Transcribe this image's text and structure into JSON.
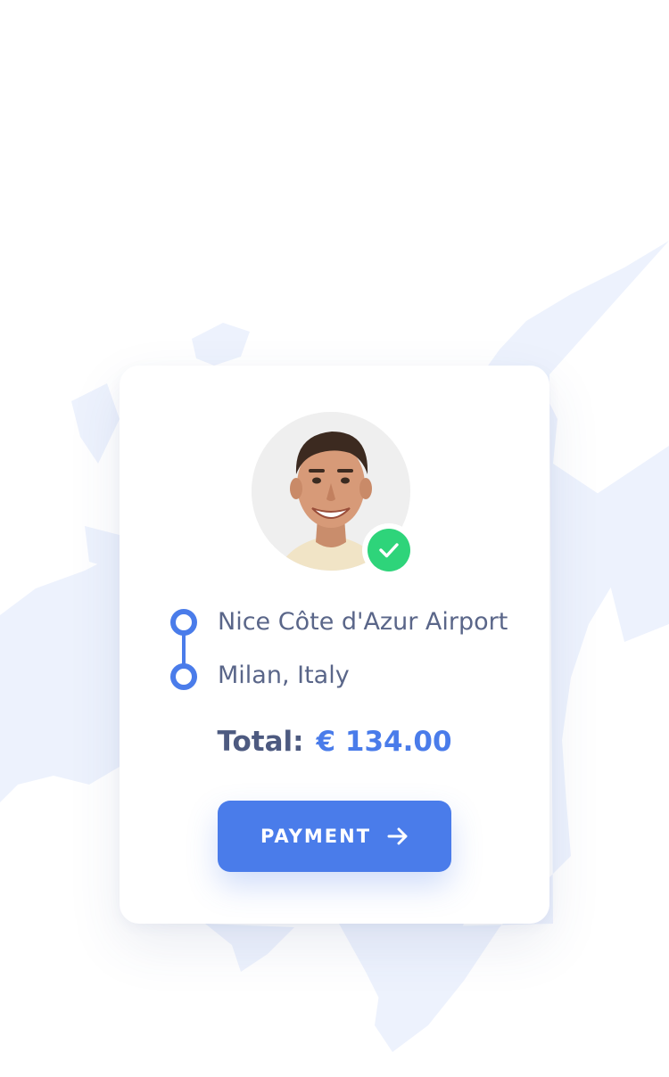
{
  "colors": {
    "accent": "#4a7cea",
    "success": "#2ed47a",
    "text_primary": "#4d5a80",
    "text_secondary": "#5a6689",
    "map_land": "#edf2fd"
  },
  "driver": {
    "avatar_icon": "driver-avatar",
    "verified_icon": "checkmark-icon"
  },
  "route": {
    "from": "Nice Côte d'Azur Airport",
    "to": "Milan, Italy"
  },
  "total": {
    "label": "Total:",
    "amount": "€ 134.00"
  },
  "payment_button": {
    "label": "PAYMENT",
    "icon": "arrow-right-icon"
  }
}
